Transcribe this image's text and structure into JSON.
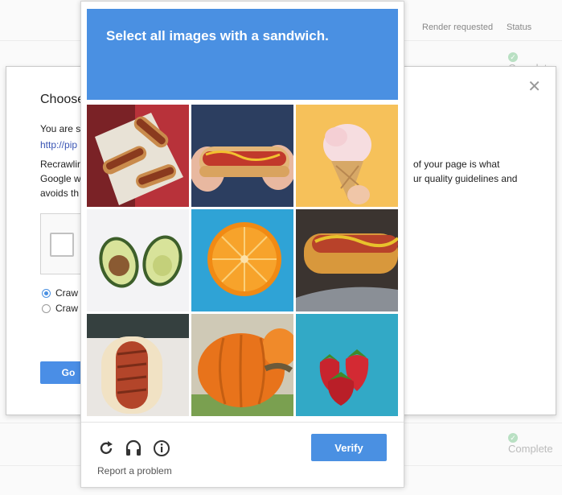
{
  "background_table": {
    "header_render": "Render requested",
    "header_status": "Status",
    "status_text": "Complete"
  },
  "dialog": {
    "title": "Choose",
    "p1": "You are s",
    "link": "http://pip",
    "p2a": "Recrawlir",
    "p2b": "Google w",
    "p2c": "avoids th",
    "right1": "of your page is what",
    "right2": "ur quality guidelines and",
    "radio1": "Craw",
    "radio2": "Craw",
    "go_label": "Go",
    "close_glyph": "✕"
  },
  "captcha": {
    "prompt": "Select all images with a sandwich.",
    "report_label": "Report a problem",
    "verify_label": "Verify",
    "tiles": [
      "hot-dogs-tray",
      "hot-dog-hands",
      "ice-cream-cone",
      "avocado-halves",
      "orange-slice",
      "hot-dog-closeup",
      "bacon-hot-dog",
      "pumpkin",
      "strawberries"
    ],
    "icons": [
      "reload-icon",
      "audio-icon",
      "info-icon"
    ]
  },
  "colors": {
    "accent": "#4a90e2"
  }
}
